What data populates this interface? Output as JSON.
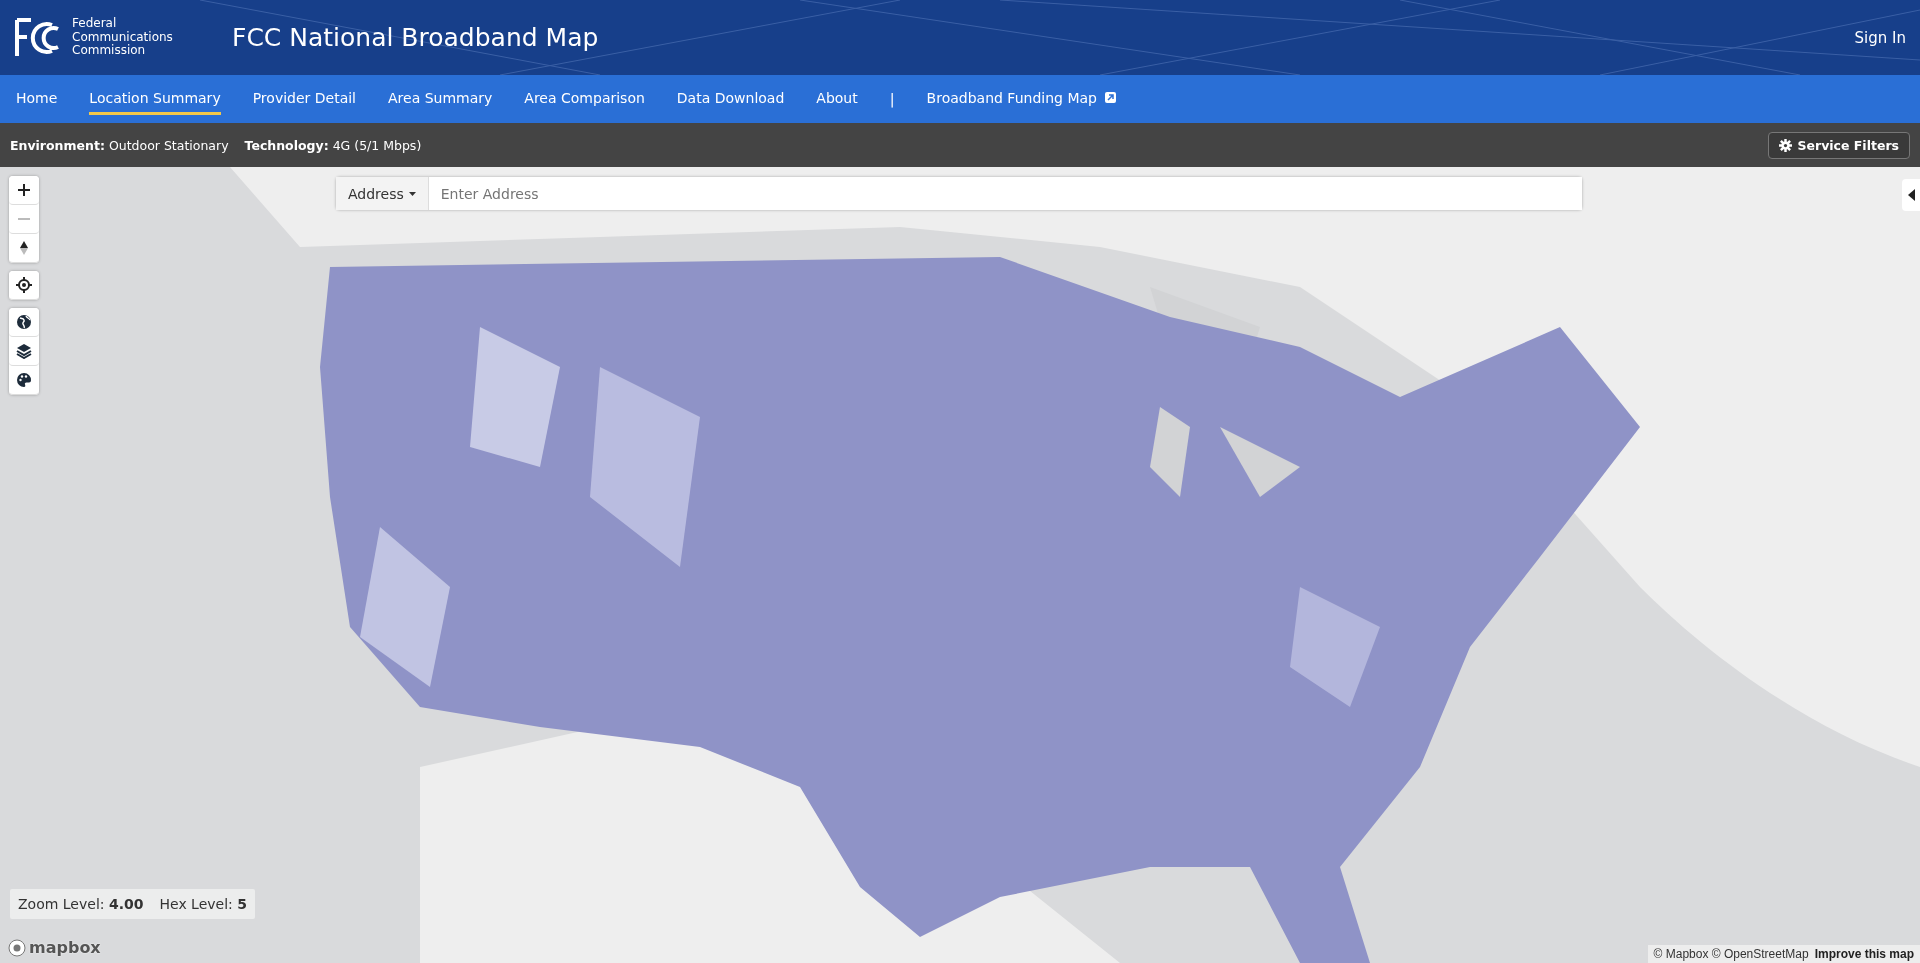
{
  "header": {
    "agency": "Federal Communications Commission",
    "title": "FCC National Broadband Map",
    "sign_in": "Sign In"
  },
  "nav": [
    {
      "kind": "link",
      "label": "Home",
      "selected": false
    },
    {
      "kind": "link",
      "label": "Location Summary",
      "selected": true
    },
    {
      "kind": "link",
      "label": "Provider Detail",
      "selected": false
    },
    {
      "kind": "link",
      "label": "Area Summary",
      "selected": false
    },
    {
      "kind": "link",
      "label": "Area Comparison",
      "selected": false
    },
    {
      "kind": "link",
      "label": "Data Download",
      "selected": false
    },
    {
      "kind": "link",
      "label": "About",
      "selected": false
    },
    {
      "kind": "separator",
      "label": "|"
    },
    {
      "kind": "external",
      "label": "Broadband Funding Map",
      "selected": false
    }
  ],
  "filter_bar": {
    "items": [
      {
        "label": "Environment:",
        "value": "Outdoor Stationary"
      },
      {
        "label": "Technology:",
        "value": "4G (5/1 Mbps)"
      }
    ],
    "button": "Service Filters"
  },
  "search": {
    "type": "Address",
    "placeholder": "Enter Address"
  },
  "map": {
    "kind": "picture",
    "control_groups": [
      [
        {
          "kind": "zoom-in",
          "disabled": false
        },
        {
          "kind": "zoom-out",
          "disabled": true
        },
        {
          "kind": "compass",
          "disabled": false
        }
      ],
      [
        {
          "kind": "locate",
          "disabled": false
        }
      ],
      [
        {
          "kind": "globe",
          "disabled": false
        },
        {
          "kind": "layers",
          "disabled": false
        },
        {
          "kind": "palette",
          "disabled": false
        }
      ]
    ],
    "zoom_level": "Zoom Level: **4.00**",
    "hex_level": "Hex Level: **5**",
    "logo": "mapbox",
    "attribution": "© Mapbox © OpenStreetMap",
    "improve_link": "Improve this map"
  }
}
